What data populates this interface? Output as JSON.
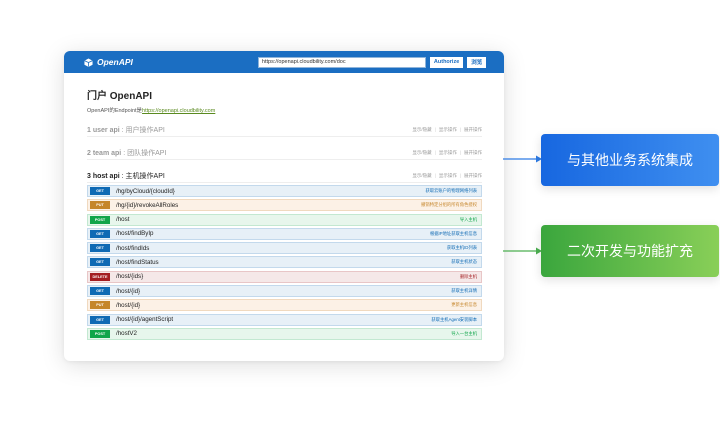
{
  "topbar": {
    "brand": "OpenAPI",
    "url_value": "https://openapi.cloudbility.com/doc",
    "authorize_label": "Authorize",
    "explore_label": "浏览"
  },
  "header": {
    "title": "门户 OpenAPI",
    "subtitle_prefix": "OpenAPI的Endpoint是",
    "endpoint_link": "https://openapi.cloudbility.com"
  },
  "groups": [
    {
      "name": "1 user api",
      "desc": " : 用户操作API",
      "show_hide": "显示/隐藏",
      "list_ops": "显示操作",
      "expand_ops": "展开操作"
    },
    {
      "name": "2 team api",
      "desc": " : 团队操作API",
      "show_hide": "显示/隐藏",
      "list_ops": "显示操作",
      "expand_ops": "展开操作"
    },
    {
      "name": "3 host api",
      "desc": " : 主机操作API",
      "show_hide": "显示/隐藏",
      "list_ops": "显示操作",
      "expand_ops": "展开操作"
    }
  ],
  "operations": [
    {
      "method": "GET",
      "path": "/hg/byCloud/{cloudId}",
      "summary": "获取云账户的物理网络列表"
    },
    {
      "method": "PUT",
      "path": "/hg/{id}/revokeAllRoles",
      "summary": "撤销特定分组的所有角色授权"
    },
    {
      "method": "POST",
      "path": "/host",
      "summary": "导入主机"
    },
    {
      "method": "GET",
      "path": "/host/findByIp",
      "summary": "根据IP地址获取主机信息"
    },
    {
      "method": "GET",
      "path": "/host/findIds",
      "summary": "获取主机ID列表"
    },
    {
      "method": "GET",
      "path": "/host/findStatus",
      "summary": "获取主机状态"
    },
    {
      "method": "DELETE",
      "path": "/host/{ids}",
      "summary": "删除主机"
    },
    {
      "method": "GET",
      "path": "/host/{id}",
      "summary": "获取主机详情"
    },
    {
      "method": "PUT",
      "path": "/host/{id}",
      "summary": "更新主机信息"
    },
    {
      "method": "GET",
      "path": "/host/{id}/agentScript",
      "summary": "获取主机Agent安装脚本"
    },
    {
      "method": "POST",
      "path": "/hostV2",
      "summary": "导入一台主机"
    }
  ],
  "callouts": {
    "integration": "与其他业务系统集成",
    "extension": "二次开发与功能扩充"
  },
  "colors": {
    "topbar": "#1b6ec2",
    "get": "#0f6ab4",
    "put": "#c5862b",
    "post": "#10a54a",
    "delete": "#a41e22",
    "callout_blue": "#1767e0",
    "callout_green": "#3aa63d"
  }
}
